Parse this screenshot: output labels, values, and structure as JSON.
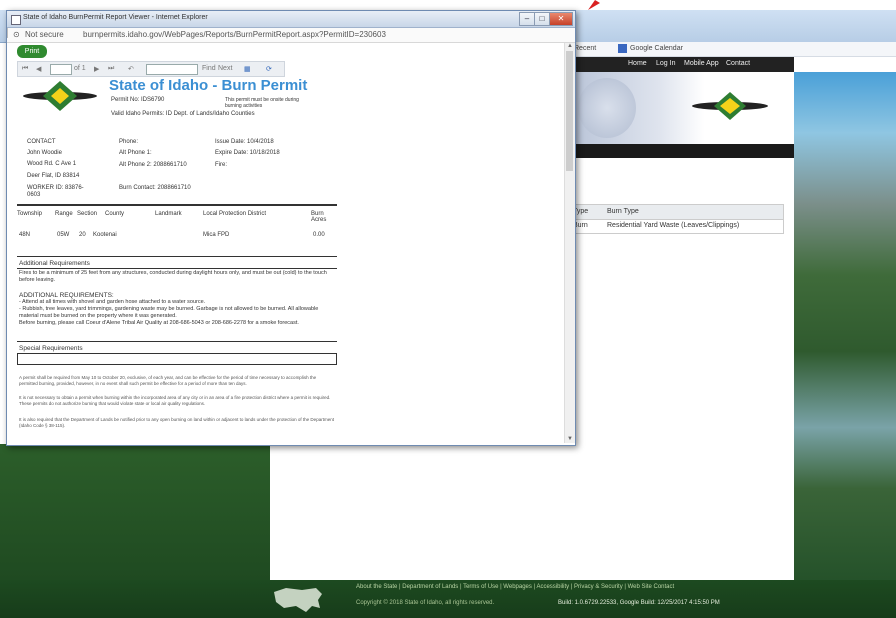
{
  "background": {
    "bookmarks": {
      "item1": "Recent",
      "item2": "Google Calendar"
    },
    "nav": [
      "Home",
      "Log In",
      "Mobile App",
      "Contact"
    ],
    "table": {
      "headers": [
        "Type",
        "Burn Type"
      ],
      "row": [
        "Burn",
        "Residential Yard Waste (Leaves/Clippings)"
      ]
    },
    "footer": {
      "links": "About the State  |  Department of Lands  |  Terms of Use  |  Webpages  |  Accessibility  |  Privacy & Security  |  Web Site Contact",
      "copyright": "Copyright © 2018 State of Idaho, all rights reserved.",
      "build": "Build: 1.0.6729.22533, Google Build: 12/25/2017 4:15:50 PM"
    }
  },
  "popup": {
    "title": "State of Idaho  BurnPermit Report Viewer - Internet Explorer",
    "address_secure": "Not secure",
    "address_url": "burnpermits.idaho.gov/WebPages/Reports/BurnPermitReport.aspx?PermitID=230603",
    "print_label": "Print",
    "toolbar": {
      "page_info": "of 1",
      "find": "Find",
      "next": "Next"
    },
    "window_buttons": {
      "min": "–",
      "max": "□",
      "close": "✕"
    }
  },
  "permit": {
    "title": "State of Idaho - Burn Permit",
    "permit_no": "Permit No: IDS6790",
    "disclaimer": "This permit must be onsite during burning activities",
    "subtitle": "Valid Idaho Permits: ID Dept. of Lands/Idaho Counties",
    "contact": {
      "label": "CONTACT",
      "name": "John Woodie",
      "addr1": "Wood Rd. C Ave 1",
      "addr2": "Deer Flat, ID 83814",
      "worker": "WORKER ID: 83876-0603"
    },
    "phones": {
      "phone": "Phone:",
      "alt1": "Alt Phone 1:",
      "alt2": "Alt Phone 2: 2088661710",
      "burn_contact": "Burn Contact: 2088661710"
    },
    "dates": {
      "issue": "Issue Date: 10/4/2018",
      "expire": "Expire Date: 10/18/2018",
      "fire": "Fire:"
    },
    "table": {
      "headers": [
        "Township",
        "Range",
        "Section",
        "County",
        "Landmark",
        "Local Protection District",
        "Burn Acres"
      ],
      "row": [
        "48N",
        "05W",
        "20",
        "Kootenai",
        "",
        "Mica FPD",
        "0.00"
      ]
    },
    "additional_title": "Additional Requirements",
    "additional_para": "Fires to be a minimum of 25 feet from any structures, conducted during daylight hours only, and must be out (cold) to the touch before leaving.",
    "additional_header": "ADDITIONAL REQUIREMENTS:",
    "additional_list": "- Attend at all times with shovel and garden hose attached to a water source.\n- Rubbish, tree leaves, yard trimmings, gardening waste may be burned. Garbage is not allowed to be burned. All allowable material must be burned on the property where it was generated.\nBefore burning, please call Coeur d'Alene Tribal Air Quality at 208-686-5043 or 208-686-2278 for a smoke forecast.",
    "special_title": "Special Requirements",
    "fine1": "A permit shall be required from May 10 to October 20, exclusive, of each year, and can be effective for the period of time necessary to accomplish the permitted burning, provided, however, in no event shall such permit be effective for a period of more than ten days.",
    "fine2": "It is not necessary to obtain a permit when burning within the incorporated area of any city or in an area of a fire protection district where a permit is required. These permits do not authorize burning that would violate state or local air quality regulations.",
    "fine3": "It is also required that the Department of Lands be notified prior to any open burning on land within or adjacent to lands under the protection of the Department (Idaho Code § 38-115)."
  }
}
